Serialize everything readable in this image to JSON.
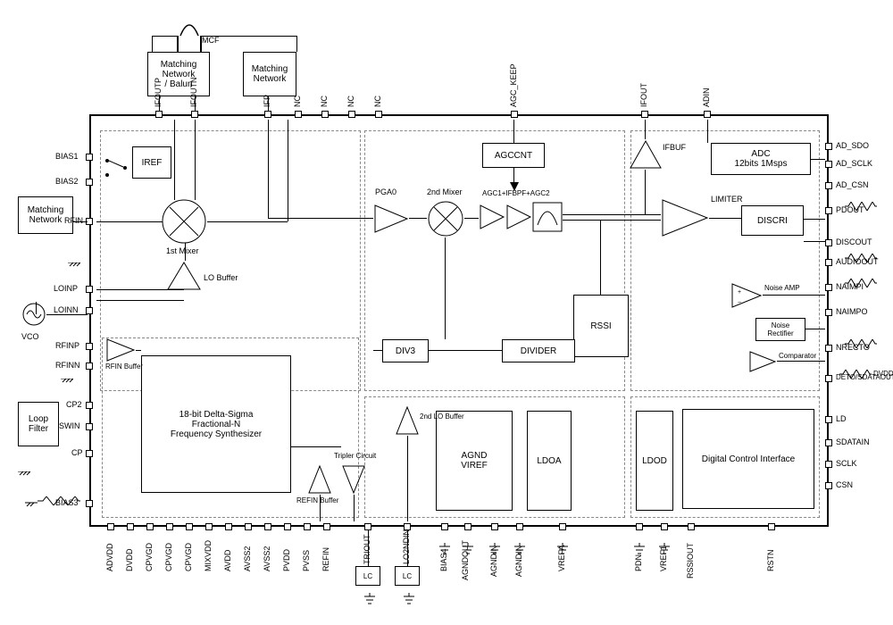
{
  "blocks": {
    "matching_balun": "Matching\nNetwork\n/ Balun",
    "matching_network": "Matching\nNetwork",
    "matching_network2": "Matching\nNetwork",
    "mcf": "MCF",
    "iref": "IREF",
    "agccnt": "AGCCNT",
    "ifbuf": "IFBUF",
    "adc": "ADC\n12bits 1Msps",
    "discri": "DISCRI",
    "rssi": "RSSI",
    "noise_amp": "Noise AMP",
    "noise_rect": "Noise\nRectifier",
    "comparator": "Comparator",
    "digital_ctrl": "Digital Control Interface",
    "agnd_viref": "AGND\nVIREF",
    "ldoa": "LDOA",
    "ldod": "LDOD",
    "divider": "DIVIDER",
    "div3": "DIV3",
    "pll": "18-bit Delta-Sigma\nFractional-N\nFrequency Synthesizer",
    "loop_filter": "Loop\nFilter",
    "lc": "LC",
    "vco": "VCO",
    "pga0": "PGA0",
    "second_mixer": "2nd Mixer",
    "agc_chain": "AGC1+IFBPF+AGC2",
    "limiter": "LIMITER",
    "lo_buffer": "LO Buffer",
    "first_mixer": "1st Mixer",
    "rfin_buffer": "RFIN Buffer",
    "refin_buffer": "REFIN Buffer",
    "tripler": "Tripler Circuit",
    "second_lo_buffer": "2nd LO Buffer"
  },
  "pins_top": [
    "IFOUTP",
    "IFOUTN",
    "IFP",
    "NC",
    "NC",
    "NC",
    "NC",
    "AGC_KEEP",
    "IFOUT",
    "ADIN"
  ],
  "pins_left": [
    "BIAS1",
    "BIAS2",
    "RFIN",
    "LOINP",
    "LOINN",
    "RFINP",
    "RFINN",
    "CP2",
    "SWIN",
    "CP",
    "BIAS3"
  ],
  "pins_right": [
    "AD_SDO",
    "AD_SCLK",
    "AD_CSN",
    "PDOUT",
    "DISCOUT",
    "AUDIOOUT",
    "NAIMPI",
    "NAIMPO",
    "NRECTO",
    "DETO/SDATAOUT",
    "LD",
    "SDATAIN",
    "SCLK",
    "CSN"
  ],
  "pins_bottom": [
    "ADVDD",
    "DVDD",
    "CPVGD",
    "CPVGD",
    "CPVGD",
    "MIXVDD",
    "AVDD",
    "AVSS2",
    "AVSS2",
    "PVDD",
    "PVSS",
    "REFIN",
    "TRIOUT",
    "LO2NDIN",
    "BIAS4",
    "AGNDOUT",
    "AGNDIN",
    "AGNDIN",
    "VREFA",
    "PDN",
    "VREF1",
    "RSSIOUT",
    "RSTN"
  ],
  "external": {
    "dvdd": "DVDD"
  }
}
